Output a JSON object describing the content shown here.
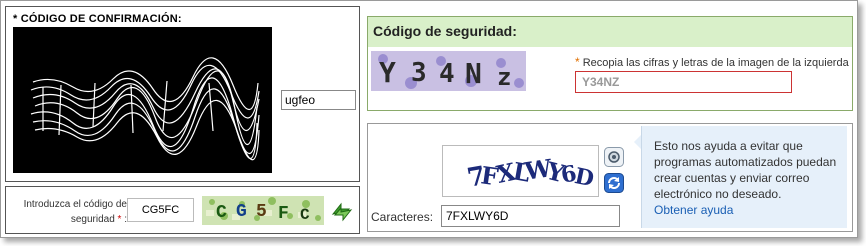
{
  "panel_confirm": {
    "title": "* CÓDIGO DE CONFIRMACIÓN:",
    "answer_value": "ugfeo"
  },
  "panel_introduce": {
    "label_line1": "Introduzca el código de",
    "label_line2": "seguridad",
    "required_mark": "*",
    "label_suffix": " :",
    "code_value": "CG5FC",
    "captcha_text": "CG5FC"
  },
  "panel_seguridad": {
    "title": "Código de seguridad:",
    "hint_mark": "*",
    "hint": "Recopia las cifras y letras de la imagen de la izquierda",
    "captcha_text": "Y34Nz",
    "input_value": "Y34NZ"
  },
  "panel_caracteres": {
    "captcha_text": "7FXLWY6D",
    "label": "Caracteres:",
    "input_value": "7FXLWY6D",
    "help_text": "Esto nos ayuda a evitar que programas automatizados puedan crear cuentas y enviar correo electrónico no deseado.",
    "help_link": "Obtener ayuda"
  },
  "icons": {
    "refresh": "refresh-arrows-icon",
    "audio": "audio-icon",
    "reload": "reload-icon"
  },
  "colors": {
    "header_green": "#d9f0c9",
    "input_error": "#cc3333",
    "help_bg": "#e6f0fa",
    "link": "#1a5fb4"
  }
}
